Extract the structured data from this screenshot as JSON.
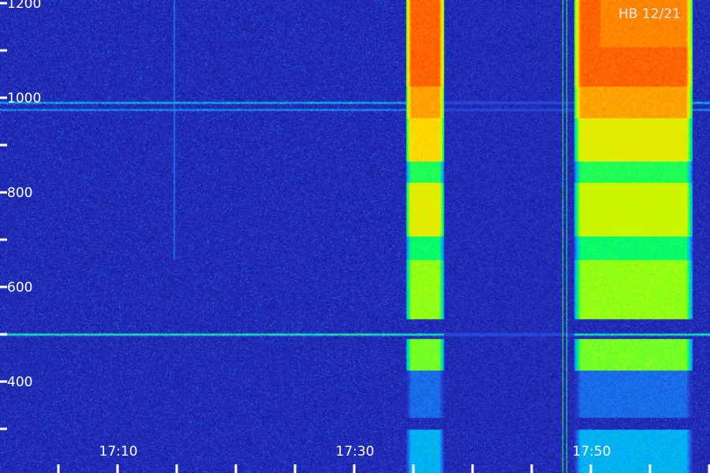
{
  "chart_data": {
    "type": "heatmap",
    "title": "",
    "xlabel": "",
    "ylabel": "",
    "corner_label": "HB 12/21",
    "x": {
      "start_minute": 1020,
      "end_minute": 1080,
      "major_ticks": [
        "17:10",
        "17:30",
        "17:50"
      ],
      "major_tick_minutes": [
        1030,
        1050,
        1070
      ],
      "minor_tick_minutes": [
        1025,
        1030,
        1035,
        1040,
        1045,
        1050,
        1055,
        1060,
        1065,
        1070,
        1075,
        1080
      ]
    },
    "y": {
      "ylim": [
        300,
        1200
      ],
      "major_ticks": [
        "400",
        "600",
        "800",
        "1000",
        "1200"
      ],
      "major_tick_values": [
        400,
        600,
        800,
        1000,
        1200
      ],
      "minor_tick_values": [
        300,
        400,
        500,
        600,
        700,
        800,
        900,
        1000,
        1100,
        1200
      ]
    },
    "colormap": [
      "#000033",
      "#1a1a99",
      "#2a3fd6",
      "#00b0ff",
      "#00ff66",
      "#b8ff00",
      "#ffe000",
      "#ff8a00",
      "#ff2000"
    ],
    "noise_bands": [
      {
        "value": 500,
        "level": 0.45
      },
      {
        "value": 990,
        "level": 0.35
      },
      {
        "value": 975,
        "level": 0.3
      }
    ],
    "events": [
      {
        "name": "burst-1",
        "x_start_minute": 1054.3,
        "x_end_minute": 1057.5,
        "peak_value": 1200,
        "intensity": "high"
      },
      {
        "name": "burst-2",
        "x_start_minute": 1068.5,
        "x_end_minute": 1078.5,
        "peak_value": 1200,
        "intensity": "high"
      }
    ]
  }
}
